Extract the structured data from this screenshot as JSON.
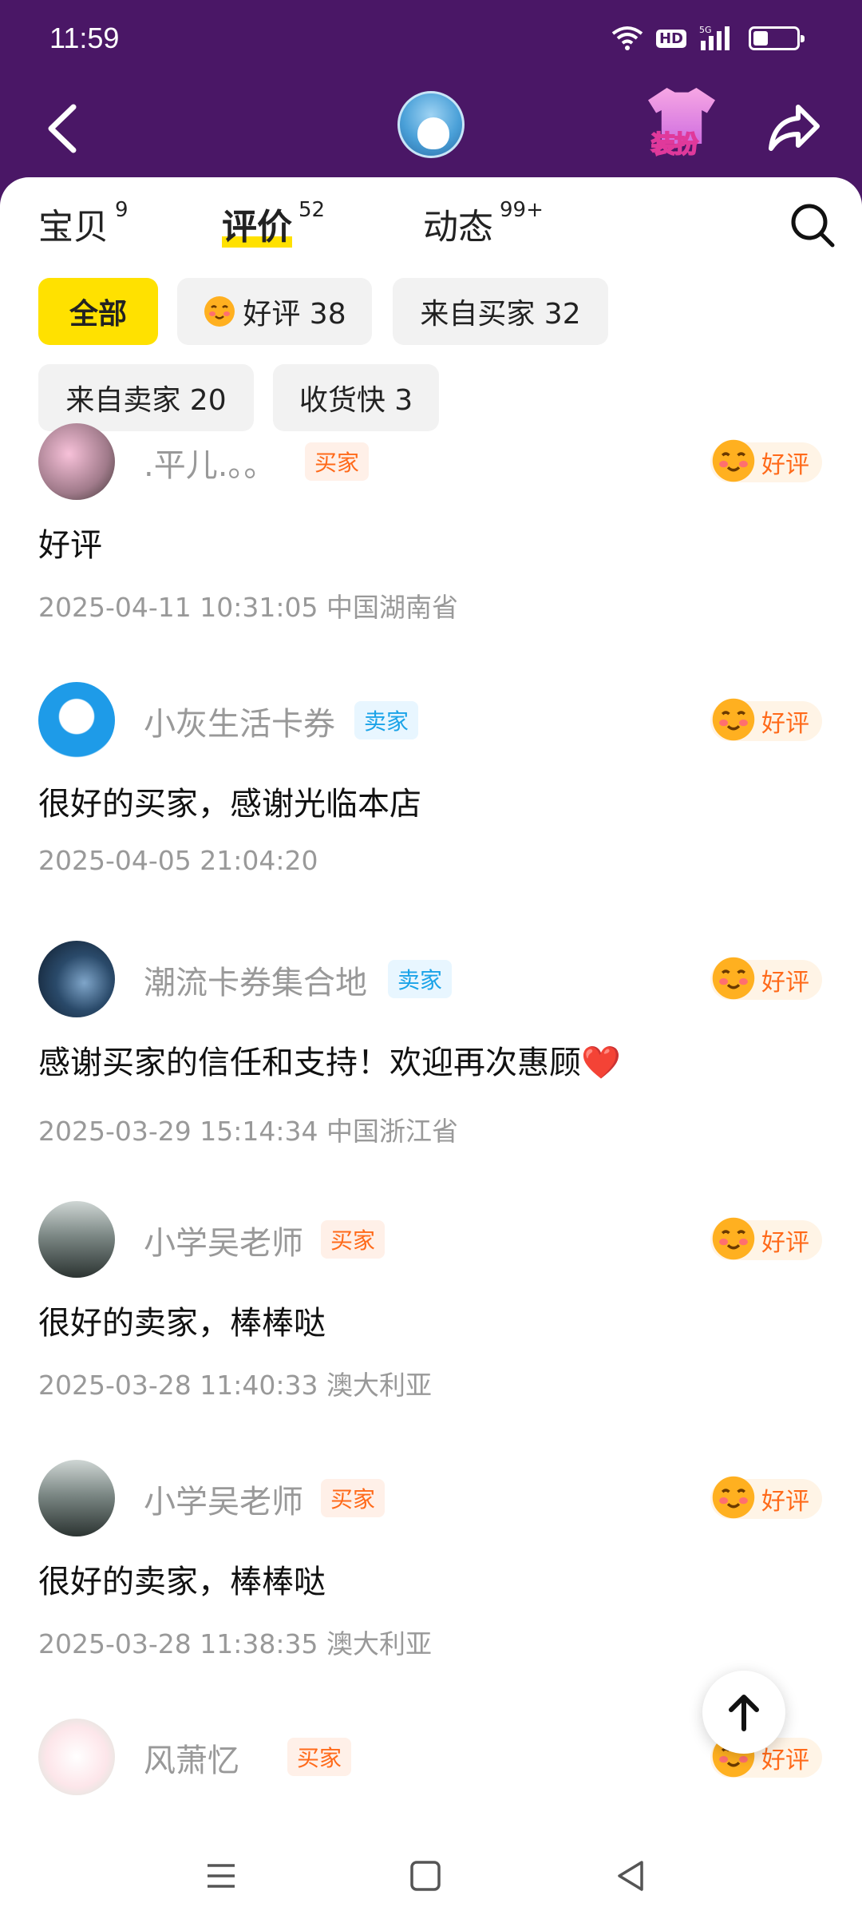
{
  "status_bar": {
    "time": "11:59",
    "network": "5G",
    "hd": "HD",
    "battery_level": 0.35
  },
  "header": {
    "dress_label": "装扮"
  },
  "tabs": [
    {
      "label": "宝贝",
      "count": "9"
    },
    {
      "label": "评价",
      "count": "52",
      "active": true
    },
    {
      "label": "动态",
      "count": "99+"
    }
  ],
  "filters": [
    {
      "label": "全部",
      "active": true
    },
    {
      "label": "好评 38"
    },
    {
      "label": "来自买家 32"
    },
    {
      "label": "来自卖家 20"
    },
    {
      "label": "收货快 3"
    }
  ],
  "reviews": [
    {
      "name": ".平儿.。。",
      "role": "买家",
      "rating": "好评",
      "comment": "好评",
      "time": "2025-04-11 10:31:05",
      "location": "中国湖南省"
    },
    {
      "name": "小灰生活卡券",
      "role": "卖家",
      "rating": "好评",
      "comment": "很好的买家，感谢光临本店",
      "time": "2025-04-05 21:04:20",
      "location": ""
    },
    {
      "name": "潮流卡券集合地",
      "role": "卖家",
      "rating": "好评",
      "comment": "感谢买家的信任和支持！欢迎再次惠顾❤️",
      "time": "2025-03-29 15:14:34",
      "location": "中国浙江省"
    },
    {
      "name": "小学吴老师",
      "role": "买家",
      "rating": "好评",
      "comment": "很好的卖家，棒棒哒",
      "time": "2025-03-28 11:40:33",
      "location": "澳大利亚"
    },
    {
      "name": "小学吴老师",
      "role": "买家",
      "rating": "好评",
      "comment": "很好的卖家，棒棒哒",
      "time": "2025-03-28 11:38:35",
      "location": "澳大利亚"
    },
    {
      "name": "风萧忆",
      "role": "买家",
      "rating": "好评",
      "comment": "",
      "time": "",
      "location": ""
    }
  ],
  "colors": {
    "header_bg": "#4a1766",
    "accent_yellow": "#ffe100",
    "buyer_tag": "#ff6a1a",
    "seller_tag": "#1aa3e8"
  }
}
